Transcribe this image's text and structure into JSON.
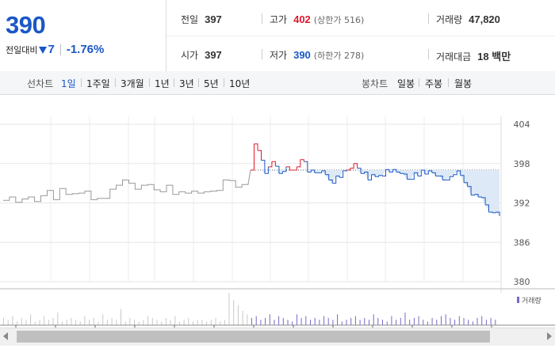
{
  "quote": {
    "price": "390",
    "diff_label": "전일대비",
    "diff_value": "7",
    "diff_rate": "-1.76%"
  },
  "info": {
    "prev_label": "전일",
    "prev_value": "397",
    "open_label": "시가",
    "open_value": "397",
    "high_label": "고가",
    "high_value": "402",
    "high_limit": "(상한가 516)",
    "low_label": "저가",
    "low_value": "390",
    "low_limit": "(하한가 278)",
    "volume_label": "거래량",
    "volume_value": "47,820",
    "amount_label": "거래대금",
    "amount_value": "18 백만"
  },
  "line_tabs": {
    "label": "선차트",
    "items": [
      "1일",
      "1주일",
      "3개월",
      "1년",
      "3년",
      "5년",
      "10년"
    ],
    "selected": "1일"
  },
  "candle_tabs": {
    "label": "봉차트",
    "items": [
      "일봉",
      "주봉",
      "월봉"
    ]
  },
  "colors": {
    "up": "#e0182e",
    "down": "#1b57c6",
    "prev_day": "#999999",
    "fill": "#dde9f6"
  },
  "chart_data": {
    "type": "line",
    "yticks": [
      "404",
      "398",
      "392",
      "386",
      "380"
    ],
    "ylim": [
      380,
      404
    ],
    "reference": 397,
    "legend": "거래량",
    "prev_day_series": [
      392.4,
      392.9,
      392.1,
      392.6,
      392.9,
      392.2,
      393.1,
      393.9,
      392.5,
      394.2,
      393.3,
      393.4,
      393.5,
      393.8,
      392.5,
      392.7,
      392.7,
      394.1,
      394.7,
      395.5,
      395.0,
      394.1,
      394.7,
      394.8,
      394.0,
      393.7,
      394.7,
      393.3,
      393.7,
      393.5,
      393.8,
      393.5,
      393.7,
      393.8,
      393.9,
      395.5,
      395.4,
      394.4,
      394.8,
      394.9
    ],
    "today_series": [
      397.0,
      401.0,
      400.0,
      398.5,
      396.5,
      397.5,
      398.3,
      397.6,
      396.5,
      396.8,
      397.5,
      397.0,
      397.0,
      397.5,
      398.6,
      398.3,
      396.7,
      397.0,
      396.6,
      396.6,
      396.9,
      396.3,
      395.5,
      395.0,
      396.1,
      395.9,
      396.9,
      397.0,
      397.3,
      398.0,
      397.3,
      396.5,
      396.7,
      395.5,
      396.3,
      396.0,
      396.2,
      396.1,
      397.1,
      396.7,
      397.1,
      396.7,
      396.5,
      396.4,
      395.6,
      395.6,
      396.6,
      396.1,
      397.0,
      396.4,
      396.9,
      396.6,
      396.1,
      396.1,
      395.5,
      395.5,
      396.0,
      396.3,
      396.9,
      396.2,
      395.1,
      394.5,
      393.2,
      393.3,
      392.9,
      392.8,
      391.7,
      390.6,
      390.5,
      390.6,
      390.0
    ],
    "volume": [
      4,
      3,
      5,
      2,
      4,
      3,
      6,
      2,
      3,
      5,
      3,
      4,
      7,
      2,
      3,
      4,
      3,
      2,
      5,
      3,
      4,
      2,
      6,
      3,
      4,
      3,
      9,
      2,
      4,
      3,
      2,
      3,
      5,
      4,
      3,
      2,
      4,
      3,
      5,
      2,
      3,
      4,
      2,
      3,
      3,
      2,
      3,
      4,
      2,
      3,
      18,
      14,
      11,
      8,
      6,
      4,
      5,
      3,
      4,
      6,
      3,
      5,
      4,
      3,
      2,
      6,
      4,
      5,
      3,
      4,
      3,
      5,
      4,
      3,
      6,
      2,
      3,
      4,
      5,
      3,
      4,
      3,
      6,
      4,
      3,
      2,
      5,
      3,
      4,
      7,
      3,
      4,
      5,
      3,
      2,
      4,
      3,
      5,
      6,
      4,
      3,
      5,
      4,
      3,
      2,
      4,
      5,
      3,
      4,
      3
    ]
  }
}
